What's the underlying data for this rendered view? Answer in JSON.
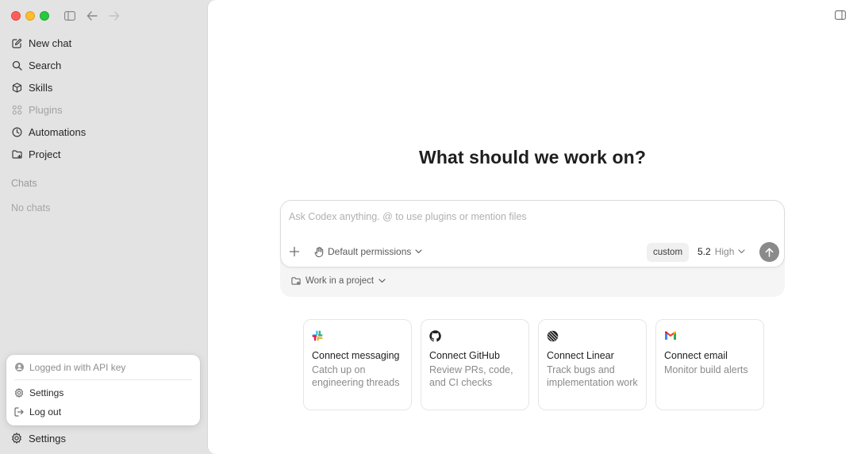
{
  "sidebar": {
    "items": [
      {
        "label": "New chat",
        "icon": "compose-icon"
      },
      {
        "label": "Search",
        "icon": "search-icon"
      },
      {
        "label": "Skills",
        "icon": "cube-icon"
      },
      {
        "label": "Plugins",
        "icon": "grid-icon"
      },
      {
        "label": "Automations",
        "icon": "clock-icon"
      },
      {
        "label": "Project",
        "icon": "folder-icon"
      }
    ],
    "chats_label": "Chats",
    "empty_label": "No chats",
    "settings_label": "Settings"
  },
  "popover": {
    "status": "Logged in with API key",
    "settings": "Settings",
    "logout": "Log out"
  },
  "main": {
    "headline": "What should we work on?",
    "composer": {
      "placeholder": "Ask Codex anything. @ to use plugins or mention files",
      "permissions": "Default permissions",
      "custom": "custom",
      "model_version": "5.2",
      "model_effort": "High",
      "project": "Work in a project"
    },
    "cards": [
      {
        "title": "Connect messaging",
        "desc": "Catch up on engineering threads",
        "icon": "slack-icon"
      },
      {
        "title": "Connect GitHub",
        "desc": "Review PRs, code, and CI checks",
        "icon": "github-icon"
      },
      {
        "title": "Connect Linear",
        "desc": "Track bugs and implementation work",
        "icon": "linear-icon"
      },
      {
        "title": "Connect email",
        "desc": "Monitor build alerts",
        "icon": "gmail-icon"
      }
    ]
  },
  "colors": {
    "sidebar_bg": "#e3e3e3",
    "main_bg": "#ffffff",
    "send_button": "#8a8a8a"
  }
}
